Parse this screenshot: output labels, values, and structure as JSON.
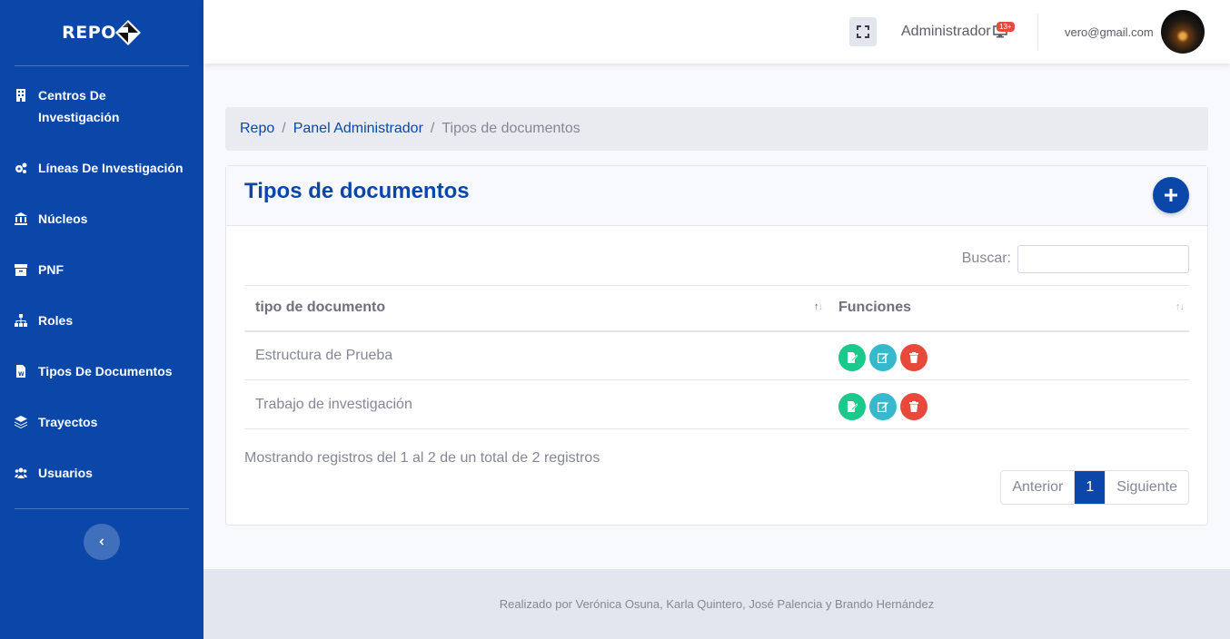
{
  "brand": {
    "text": "REPO"
  },
  "sidebar": {
    "items": [
      {
        "label": "Centros De Investigación",
        "icon": "building-icon"
      },
      {
        "label": "Líneas De Investigación",
        "icon": "cogs-icon"
      },
      {
        "label": "Núcleos",
        "icon": "university-icon"
      },
      {
        "label": "PNF",
        "icon": "archive-icon"
      },
      {
        "label": "Roles",
        "icon": "sitemap-icon"
      },
      {
        "label": "Tipos De Documentos",
        "icon": "file-word-icon"
      },
      {
        "label": "Trayectos",
        "icon": "layer-group-icon"
      },
      {
        "label": "Usuarios",
        "icon": "users-icon"
      }
    ],
    "toggle_icon": "chevron-left-icon"
  },
  "topbar": {
    "user_role": "Administrador",
    "badge": "13+",
    "email": "vero@gmail.com"
  },
  "breadcrumb": {
    "items": [
      "Repo",
      "Panel Administrador"
    ],
    "current": "Tipos de documentos"
  },
  "card": {
    "title": "Tipos de documentos",
    "search_label": "Buscar:",
    "search_value": "",
    "columns": [
      "tipo de documento",
      "Funciones"
    ],
    "rows": [
      {
        "name": "Estructura de Prueba"
      },
      {
        "name": "Trabajo de investigación"
      }
    ],
    "info": "Mostrando registros del 1 al 2 de un total de 2 registros",
    "pager": {
      "prev": "Anterior",
      "page": "1",
      "next": "Siguiente"
    }
  },
  "footer": {
    "text": "Realizado por Verónica Osuna, Karla Quintero, José Palencia y Brando Hernández"
  },
  "colors": {
    "primary": "#0b47a8",
    "success": "#1cc88a",
    "info": "#36b9cc",
    "danger": "#e74a3b"
  }
}
